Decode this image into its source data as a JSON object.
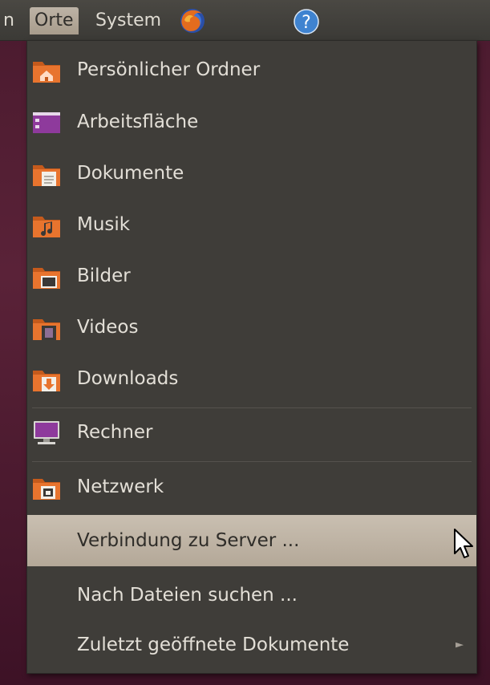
{
  "panel": {
    "partial_label": "n",
    "places_label": "Orte",
    "system_label": "System",
    "help_glyph": "?"
  },
  "menu": {
    "items": [
      {
        "label": "Persönlicher Ordner",
        "icon": "home-folder-icon"
      },
      {
        "label": "Arbeitsfläche",
        "icon": "desktop-icon"
      },
      {
        "label": "Dokumente",
        "icon": "documents-folder-icon"
      },
      {
        "label": "Musik",
        "icon": "music-folder-icon"
      },
      {
        "label": "Bilder",
        "icon": "pictures-folder-icon"
      },
      {
        "label": "Videos",
        "icon": "videos-folder-icon"
      },
      {
        "label": "Downloads",
        "icon": "downloads-folder-icon"
      },
      {
        "label": "Rechner",
        "icon": "computer-icon"
      },
      {
        "label": "Netzwerk",
        "icon": "network-folder-icon"
      },
      {
        "label": "Verbindung zu Server ...",
        "highlighted": true
      },
      {
        "label": "Nach Dateien suchen ..."
      },
      {
        "label": "Zuletzt geöffnete Dokumente",
        "submenu_arrow": "►"
      }
    ]
  },
  "colors": {
    "panel_bg": "#3b3a36",
    "menu_bg": "#3f3d39",
    "highlight": "#bdb3a6",
    "text": "#e3dfd7",
    "folder_orange": "#e8742e",
    "desktop_purple": "#8e3a9c"
  }
}
